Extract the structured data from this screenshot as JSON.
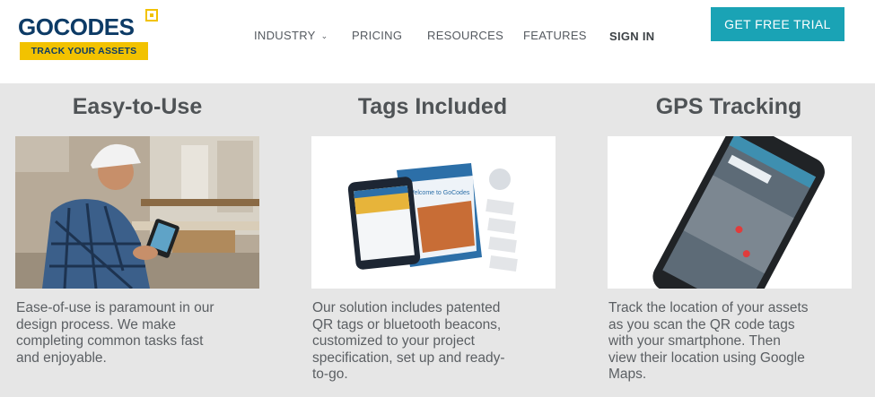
{
  "brand": {
    "name": "GOCODES",
    "tagline": "TRACK YOUR ASSETS",
    "accent": "#f2c200",
    "navy": "#0d3b66"
  },
  "nav": {
    "items": [
      {
        "label": "INDUSTRY",
        "has_dropdown": true
      },
      {
        "label": "PRICING"
      },
      {
        "label": "RESOURCES"
      },
      {
        "label": "FEATURES"
      },
      {
        "label": "SIGN IN"
      }
    ],
    "cta": "GET FREE TRIAL",
    "cta_color": "#1aa3b5"
  },
  "features": [
    {
      "title": "Easy-to-Use",
      "image": "construction-worker-with-tablet",
      "desc_lines": [
        "Ease-of-use is paramount in our",
        "design process. We make",
        "completing common tasks fast",
        "and enjoyable."
      ]
    },
    {
      "title": "Tags Included",
      "image": "welcome-to-gocodes-kit-with-tags",
      "card_text": "Welcome to GoCodes",
      "desc_lines": [
        "Our solution includes patented",
        "QR tags or bluetooth beacons,",
        "customized to your project",
        "specification, set up and ready-",
        "to-go."
      ]
    },
    {
      "title": "GPS Tracking",
      "image": "smartphone-with-map",
      "desc_lines": [
        "Track the location of your assets",
        "as you scan the QR code tags",
        "with your smartphone. Then",
        "view their location using Google",
        "Maps."
      ]
    }
  ]
}
